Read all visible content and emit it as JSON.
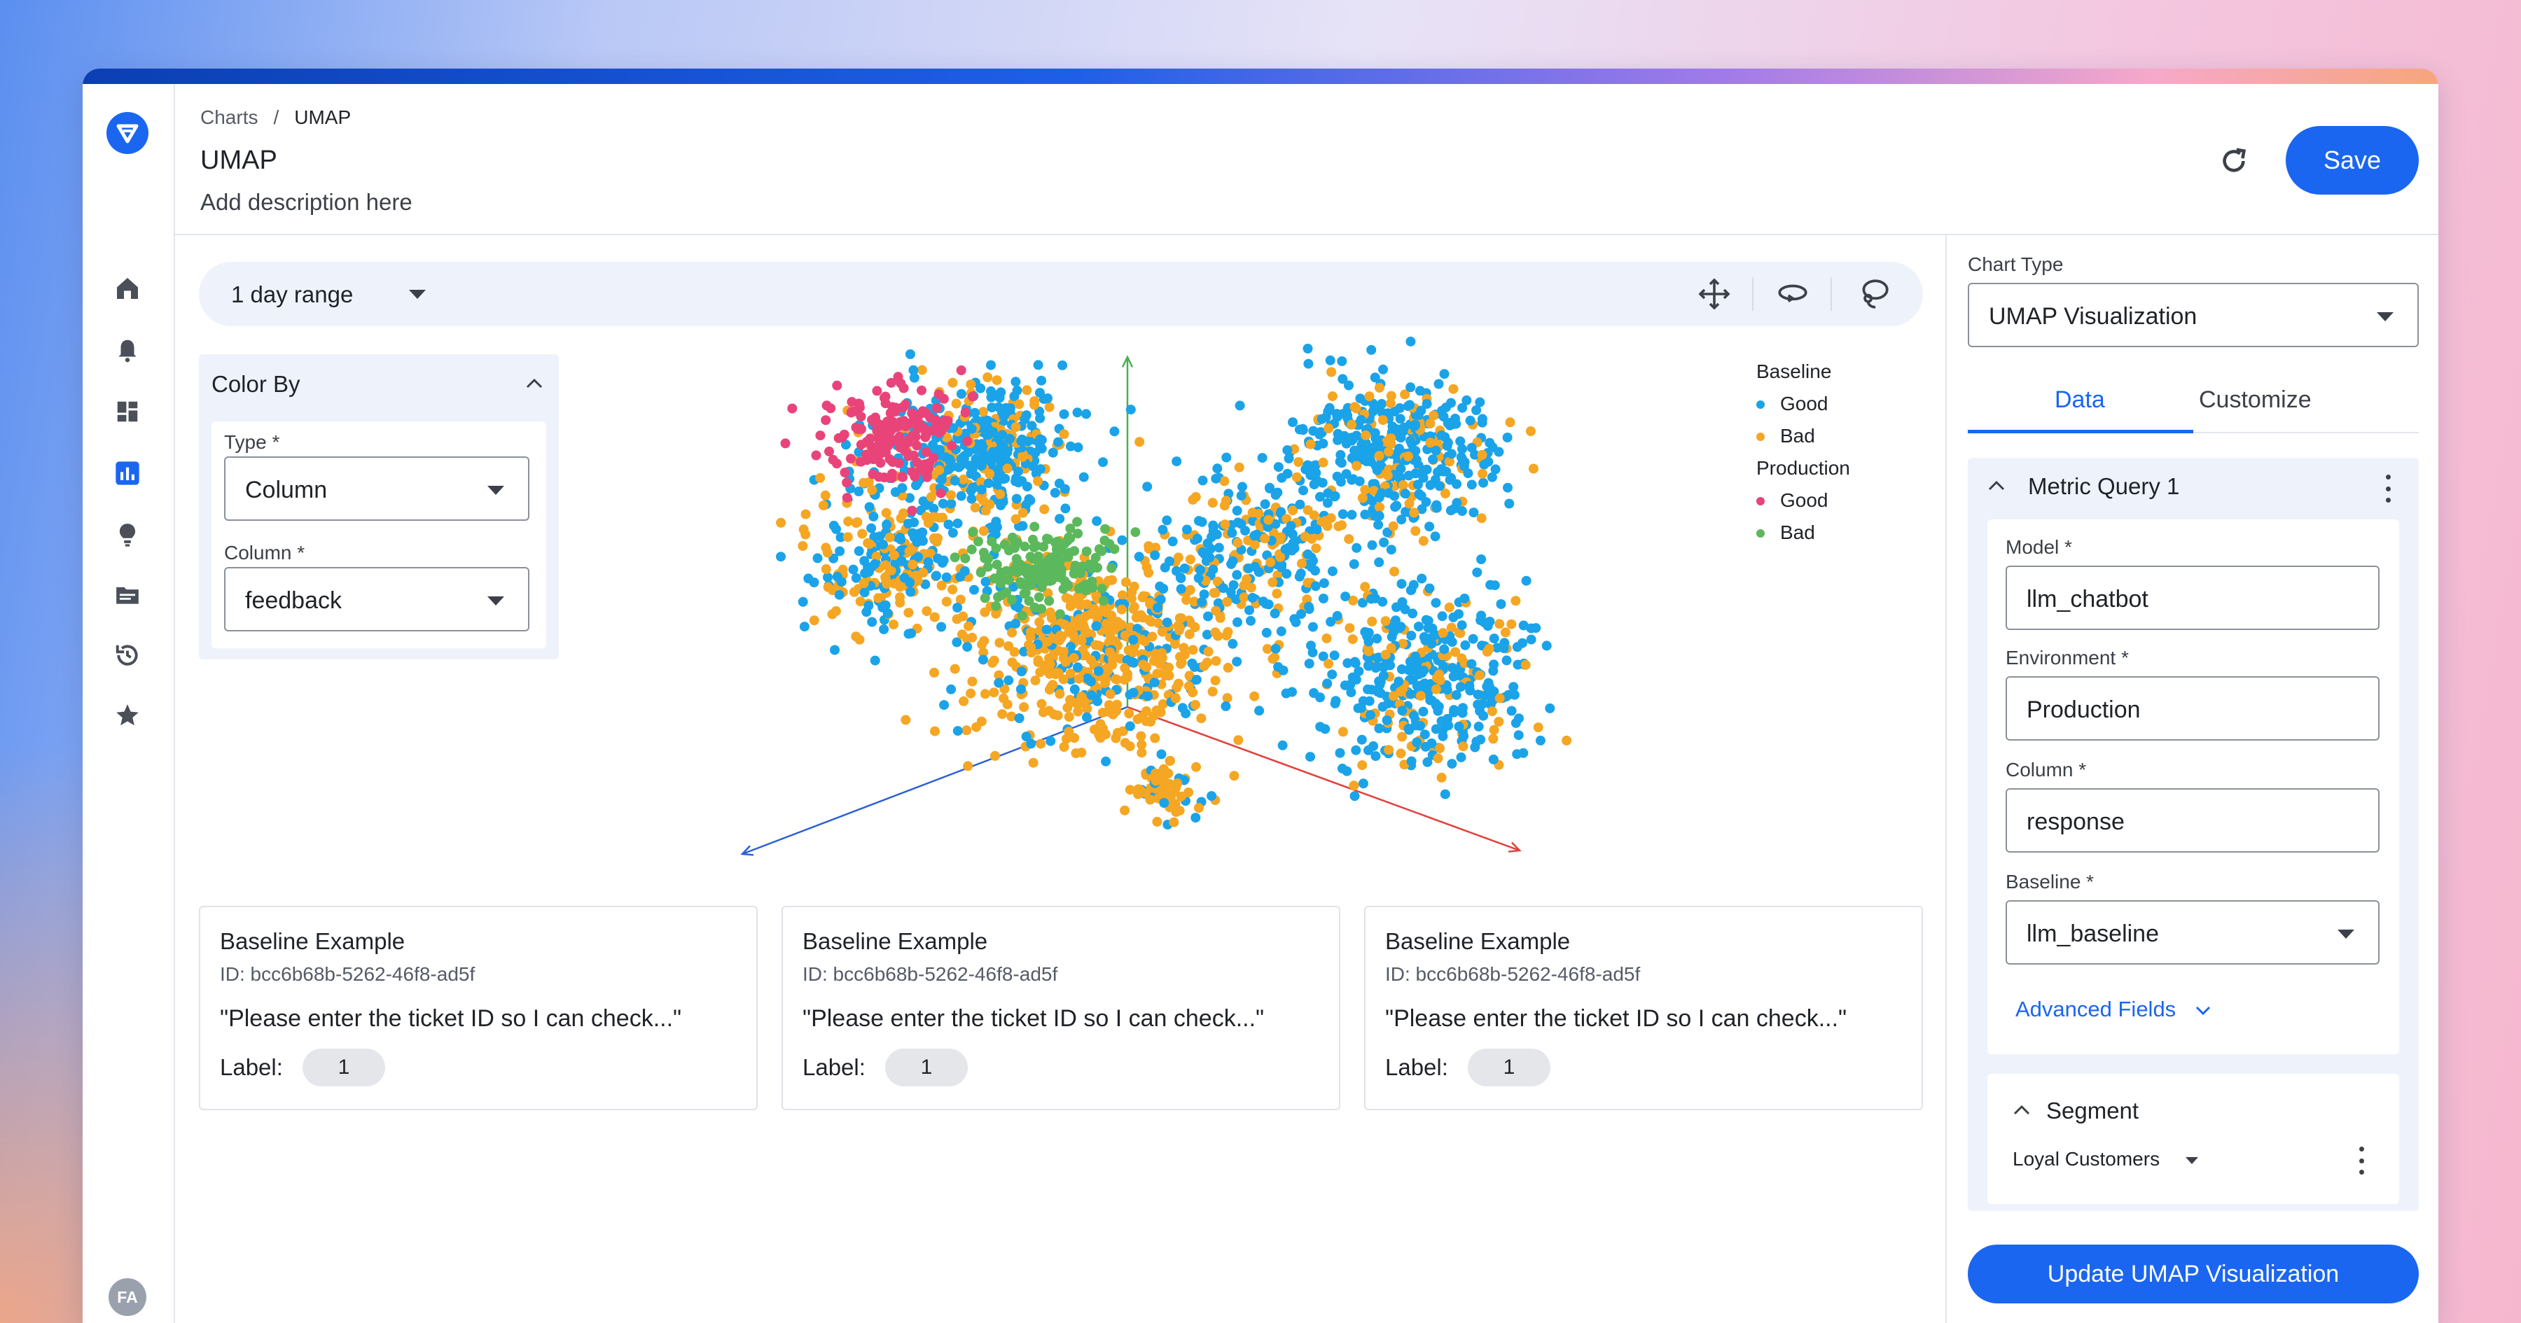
{
  "breadcrumb": {
    "parent": "Charts",
    "separator": "/",
    "current": "UMAP"
  },
  "header": {
    "title": "UMAP",
    "description": "Add description here",
    "save_label": "Save"
  },
  "toolbar": {
    "range_label": "1 day range"
  },
  "color_by": {
    "title": "Color By",
    "type_label": "Type *",
    "type_value": "Column",
    "column_label": "Column *",
    "column_value": "feedback"
  },
  "legend": {
    "groups": [
      {
        "name": "Baseline",
        "items": [
          {
            "label": "Good",
            "color": "#1aa3e8"
          },
          {
            "label": "Bad",
            "color": "#f5a623"
          }
        ]
      },
      {
        "name": "Production",
        "items": [
          {
            "label": "Good",
            "color": "#e8447a"
          },
          {
            "label": "Bad",
            "color": "#5cb85c"
          }
        ]
      }
    ]
  },
  "chart_data": {
    "type": "scatter",
    "description_of_axes": "3D UMAP projection with three axis arrows (green up, blue lower-left, red lower-right); no tick labels",
    "series": [
      {
        "name": "Good",
        "color": "#1aa3e8"
      },
      {
        "name": "Bad",
        "color": "#f5a623"
      },
      {
        "name": "Good",
        "color": "#e8447a"
      },
      {
        "name": "Bad",
        "color": "#5cb85c"
      }
    ],
    "legend_position": "top-right",
    "grid": false
  },
  "cards": [
    {
      "title": "Baseline Example",
      "id": "ID: bcc6b68b-5262-46f8-ad5f",
      "quote": "\"Please enter the ticket ID so I can check...\"",
      "label_text": "Label:",
      "label_value": "1"
    },
    {
      "title": "Baseline Example",
      "id": "ID: bcc6b68b-5262-46f8-ad5f",
      "quote": "\"Please enter the ticket ID so I can check...\"",
      "label_text": "Label:",
      "label_value": "1"
    },
    {
      "title": "Baseline Example",
      "id": "ID: bcc6b68b-5262-46f8-ad5f",
      "quote": "\"Please enter the ticket ID so I can check...\"",
      "label_text": "Label:",
      "label_value": "1"
    }
  ],
  "right_panel": {
    "chart_type_label": "Chart Type",
    "chart_type_value": "UMAP Visualization",
    "tabs": [
      "Data",
      "Customize"
    ],
    "active_tab": "Data",
    "metric_query": {
      "title": "Metric Query 1",
      "fields": [
        {
          "label": "Model *",
          "value": "llm_chatbot"
        },
        {
          "label": "Environment *",
          "value": "Production"
        },
        {
          "label": "Column *",
          "value": "response"
        },
        {
          "label": "Baseline *",
          "value": "llm_baseline"
        }
      ],
      "advanced_label": "Advanced Fields"
    },
    "segment": {
      "title": "Segment",
      "value": "Loyal Customers"
    },
    "update_label": "Update UMAP Visualization"
  },
  "user": {
    "initials": "FA"
  },
  "icons": [
    "logo-icon",
    "home-icon",
    "bell-icon",
    "dashboard-icon",
    "chart-icon",
    "lightbulb-icon",
    "folder-icon",
    "history-icon",
    "star-icon",
    "refresh-icon",
    "pan-icon",
    "rotate-icon",
    "lasso-icon",
    "chevron-up-icon",
    "chevron-down-icon",
    "kebab-icon"
  ]
}
